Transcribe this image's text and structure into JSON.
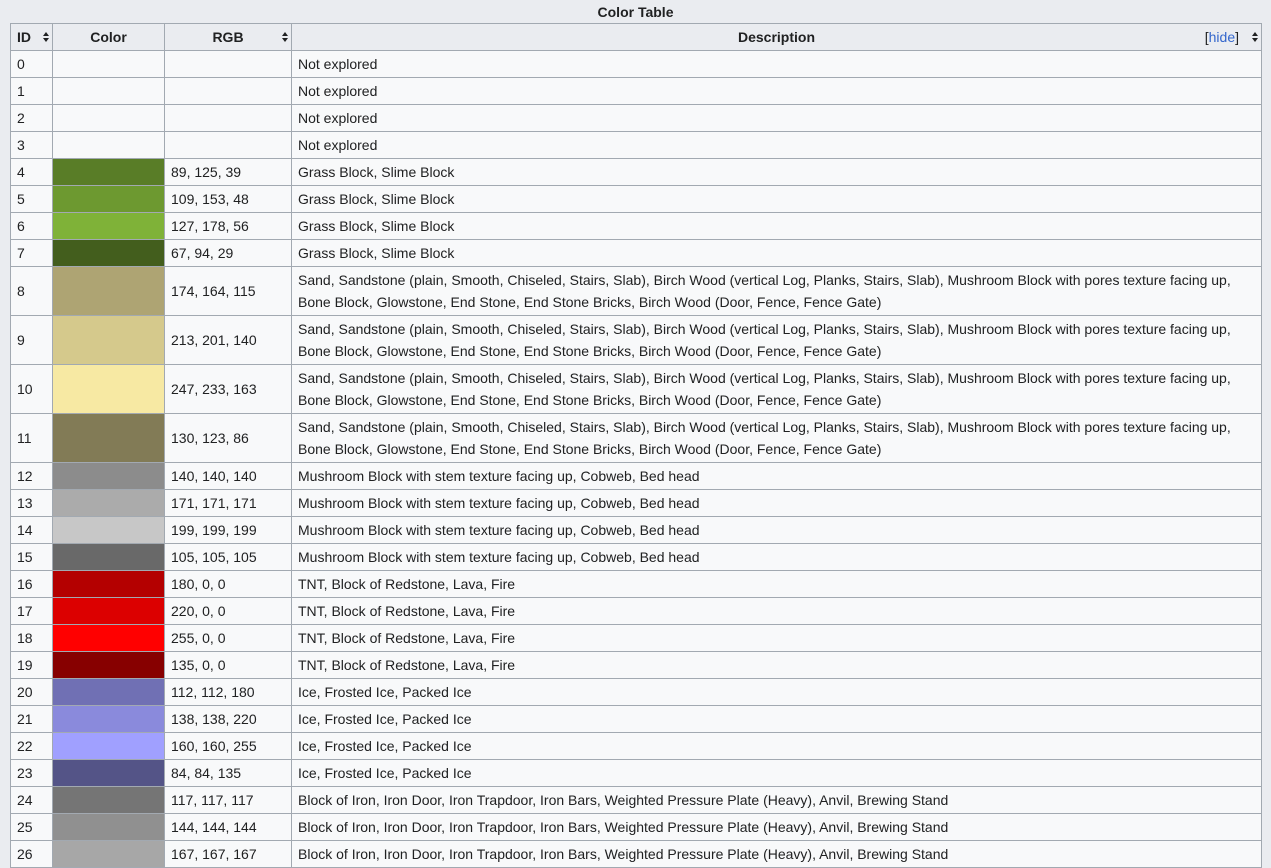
{
  "caption": "Color Table",
  "headers": {
    "id": "ID",
    "color": "Color",
    "rgb": "RGB",
    "description": "Description"
  },
  "hide_toggle": {
    "open": "[",
    "link": "hide",
    "close": "]"
  },
  "rows": [
    {
      "id": "0",
      "rgb": "",
      "color": "",
      "description": "Not explored"
    },
    {
      "id": "1",
      "rgb": "",
      "color": "",
      "description": "Not explored"
    },
    {
      "id": "2",
      "rgb": "",
      "color": "",
      "description": "Not explored"
    },
    {
      "id": "3",
      "rgb": "",
      "color": "",
      "description": "Not explored"
    },
    {
      "id": "4",
      "rgb": "89, 125, 39",
      "color": "#597d27",
      "description": "Grass Block, Slime Block"
    },
    {
      "id": "5",
      "rgb": "109, 153, 48",
      "color": "#6d9930",
      "description": "Grass Block, Slime Block"
    },
    {
      "id": "6",
      "rgb": "127, 178, 56",
      "color": "#7fb238",
      "description": "Grass Block, Slime Block"
    },
    {
      "id": "7",
      "rgb": "67, 94, 29",
      "color": "#435e1d",
      "description": "Grass Block, Slime Block"
    },
    {
      "id": "8",
      "rgb": "174, 164, 115",
      "color": "#aea473",
      "description": "Sand, Sandstone (plain, Smooth, Chiseled, Stairs, Slab), Birch Wood (vertical Log, Planks, Stairs, Slab), Mushroom Block with pores texture facing up, Bone Block, Glowstone, End Stone, End Stone Bricks, Birch Wood (Door, Fence, Fence Gate)"
    },
    {
      "id": "9",
      "rgb": "213, 201, 140",
      "color": "#d5c98c",
      "description": "Sand, Sandstone (plain, Smooth, Chiseled, Stairs, Slab), Birch Wood (vertical Log, Planks, Stairs, Slab), Mushroom Block with pores texture facing up, Bone Block, Glowstone, End Stone, End Stone Bricks, Birch Wood (Door, Fence, Fence Gate)"
    },
    {
      "id": "10",
      "rgb": "247, 233, 163",
      "color": "#f7e9a3",
      "description": "Sand, Sandstone (plain, Smooth, Chiseled, Stairs, Slab), Birch Wood (vertical Log, Planks, Stairs, Slab), Mushroom Block with pores texture facing up, Bone Block, Glowstone, End Stone, End Stone Bricks, Birch Wood (Door, Fence, Fence Gate)"
    },
    {
      "id": "11",
      "rgb": "130, 123, 86",
      "color": "#827b56",
      "description": "Sand, Sandstone (plain, Smooth, Chiseled, Stairs, Slab), Birch Wood (vertical Log, Planks, Stairs, Slab), Mushroom Block with pores texture facing up, Bone Block, Glowstone, End Stone, End Stone Bricks, Birch Wood (Door, Fence, Fence Gate)"
    },
    {
      "id": "12",
      "rgb": "140, 140, 140",
      "color": "#8c8c8c",
      "description": "Mushroom Block with stem texture facing up, Cobweb, Bed head"
    },
    {
      "id": "13",
      "rgb": "171, 171, 171",
      "color": "#ababab",
      "description": "Mushroom Block with stem texture facing up, Cobweb, Bed head"
    },
    {
      "id": "14",
      "rgb": "199, 199, 199",
      "color": "#c7c7c7",
      "description": "Mushroom Block with stem texture facing up, Cobweb, Bed head"
    },
    {
      "id": "15",
      "rgb": "105, 105, 105",
      "color": "#696969",
      "description": "Mushroom Block with stem texture facing up, Cobweb, Bed head"
    },
    {
      "id": "16",
      "rgb": "180, 0, 0",
      "color": "#b40000",
      "description": "TNT, Block of Redstone, Lava, Fire"
    },
    {
      "id": "17",
      "rgb": "220, 0, 0",
      "color": "#dc0000",
      "description": "TNT, Block of Redstone, Lava, Fire"
    },
    {
      "id": "18",
      "rgb": "255, 0, 0",
      "color": "#ff0000",
      "description": "TNT, Block of Redstone, Lava, Fire"
    },
    {
      "id": "19",
      "rgb": "135, 0, 0",
      "color": "#870000",
      "description": "TNT, Block of Redstone, Lava, Fire"
    },
    {
      "id": "20",
      "rgb": "112, 112, 180",
      "color": "#7070b4",
      "description": "Ice, Frosted Ice, Packed Ice"
    },
    {
      "id": "21",
      "rgb": "138, 138, 220",
      "color": "#8a8adc",
      "description": "Ice, Frosted Ice, Packed Ice"
    },
    {
      "id": "22",
      "rgb": "160, 160, 255",
      "color": "#a0a0ff",
      "description": "Ice, Frosted Ice, Packed Ice"
    },
    {
      "id": "23",
      "rgb": "84, 84, 135",
      "color": "#545487",
      "description": "Ice, Frosted Ice, Packed Ice"
    },
    {
      "id": "24",
      "rgb": "117, 117, 117",
      "color": "#757575",
      "description": "Block of Iron, Iron Door, Iron Trapdoor, Iron Bars, Weighted Pressure Plate (Heavy), Anvil, Brewing Stand"
    },
    {
      "id": "25",
      "rgb": "144, 144, 144",
      "color": "#909090",
      "description": "Block of Iron, Iron Door, Iron Trapdoor, Iron Bars, Weighted Pressure Plate (Heavy), Anvil, Brewing Stand"
    },
    {
      "id": "26",
      "rgb": "167, 167, 167",
      "color": "#a7a7a7",
      "description": "Block of Iron, Iron Door, Iron Trapdoor, Iron Bars, Weighted Pressure Plate (Heavy), Anvil, Brewing Stand"
    }
  ]
}
